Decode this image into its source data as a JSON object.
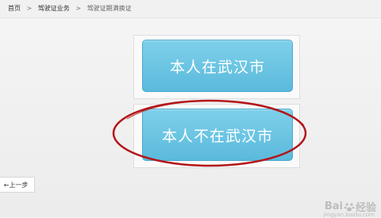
{
  "breadcrumb": {
    "home": "首页",
    "section": "驾驶证业务",
    "current": "驾驶证期满换证",
    "separator": ">"
  },
  "options": {
    "in_wuhan": "本人在武汉市",
    "not_in_wuhan": "本人不在武汉市"
  },
  "nav": {
    "back": "←上一步"
  },
  "watermark": {
    "brand_left": "Bai",
    "brand_right": "经验",
    "sub": "jingyan.baidu.com"
  },
  "colors": {
    "button_blue": "#6cc5e6",
    "highlight_circle": "#b3161a"
  }
}
